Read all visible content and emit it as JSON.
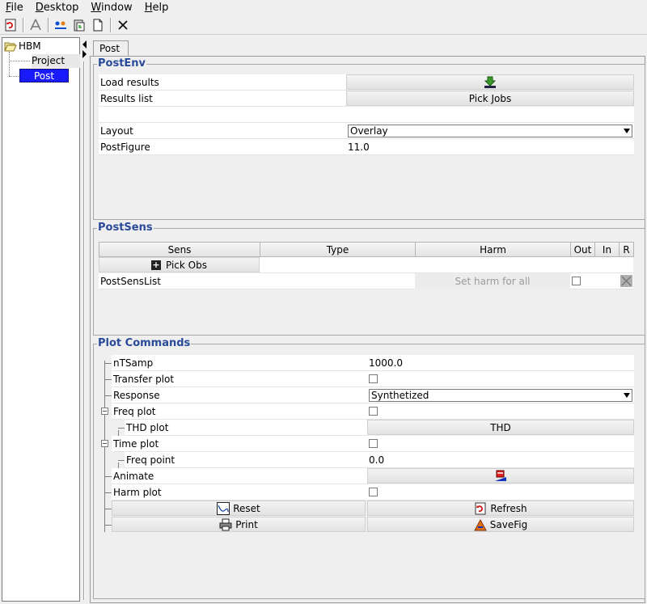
{
  "menubar": {
    "items": [
      {
        "underline": "F",
        "rest": "ile"
      },
      {
        "underline": "D",
        "rest": "esktop"
      },
      {
        "underline": "W",
        "rest": "indow"
      },
      {
        "underline": "H",
        "rest": "elp"
      }
    ]
  },
  "toolbar": {
    "icons": [
      "refresh-icon",
      "tool-icon",
      "connect-icon",
      "clipboard-icon",
      "new-page-icon",
      "close-icon"
    ]
  },
  "tree": {
    "root": "HBM",
    "children": [
      "Project",
      "Post"
    ],
    "selected": "Post"
  },
  "tabs": {
    "active": "Post"
  },
  "postenv": {
    "title": "PostEnv",
    "load_results": "Load results",
    "results_list": "Results list",
    "pick_jobs": "Pick Jobs",
    "layout_label": "Layout",
    "layout_value": "Overlay",
    "postfigure_label": "PostFigure",
    "postfigure_value": "11.0"
  },
  "postsens": {
    "title": "PostSens",
    "columns": [
      "Sens",
      "Type",
      "Harm",
      "Out",
      "In",
      "R"
    ],
    "pick_obs": "Pick Obs",
    "list_label": "PostSensList",
    "set_harm": "Set harm for all"
  },
  "plot": {
    "title": "Plot Commands",
    "ntsamp_label": "nTSamp",
    "ntsamp_value": "1000.0",
    "transfer_label": "Transfer plot",
    "response_label": "Response",
    "response_value": "Synthetized",
    "freq_label": "Freq plot",
    "thd_label": "THD plot",
    "thd_button": "THD",
    "time_label": "Time plot",
    "freqpoint_label": "Freq point",
    "freqpoint_value": "0.0",
    "animate_label": "Animate",
    "harm_label": "Harm plot",
    "reset": "Reset",
    "refresh": "Refresh",
    "print": "Print",
    "savefig": "SaveFig"
  },
  "colors": {
    "accent": "#2a4a9a",
    "selection": "#1a1aff"
  }
}
